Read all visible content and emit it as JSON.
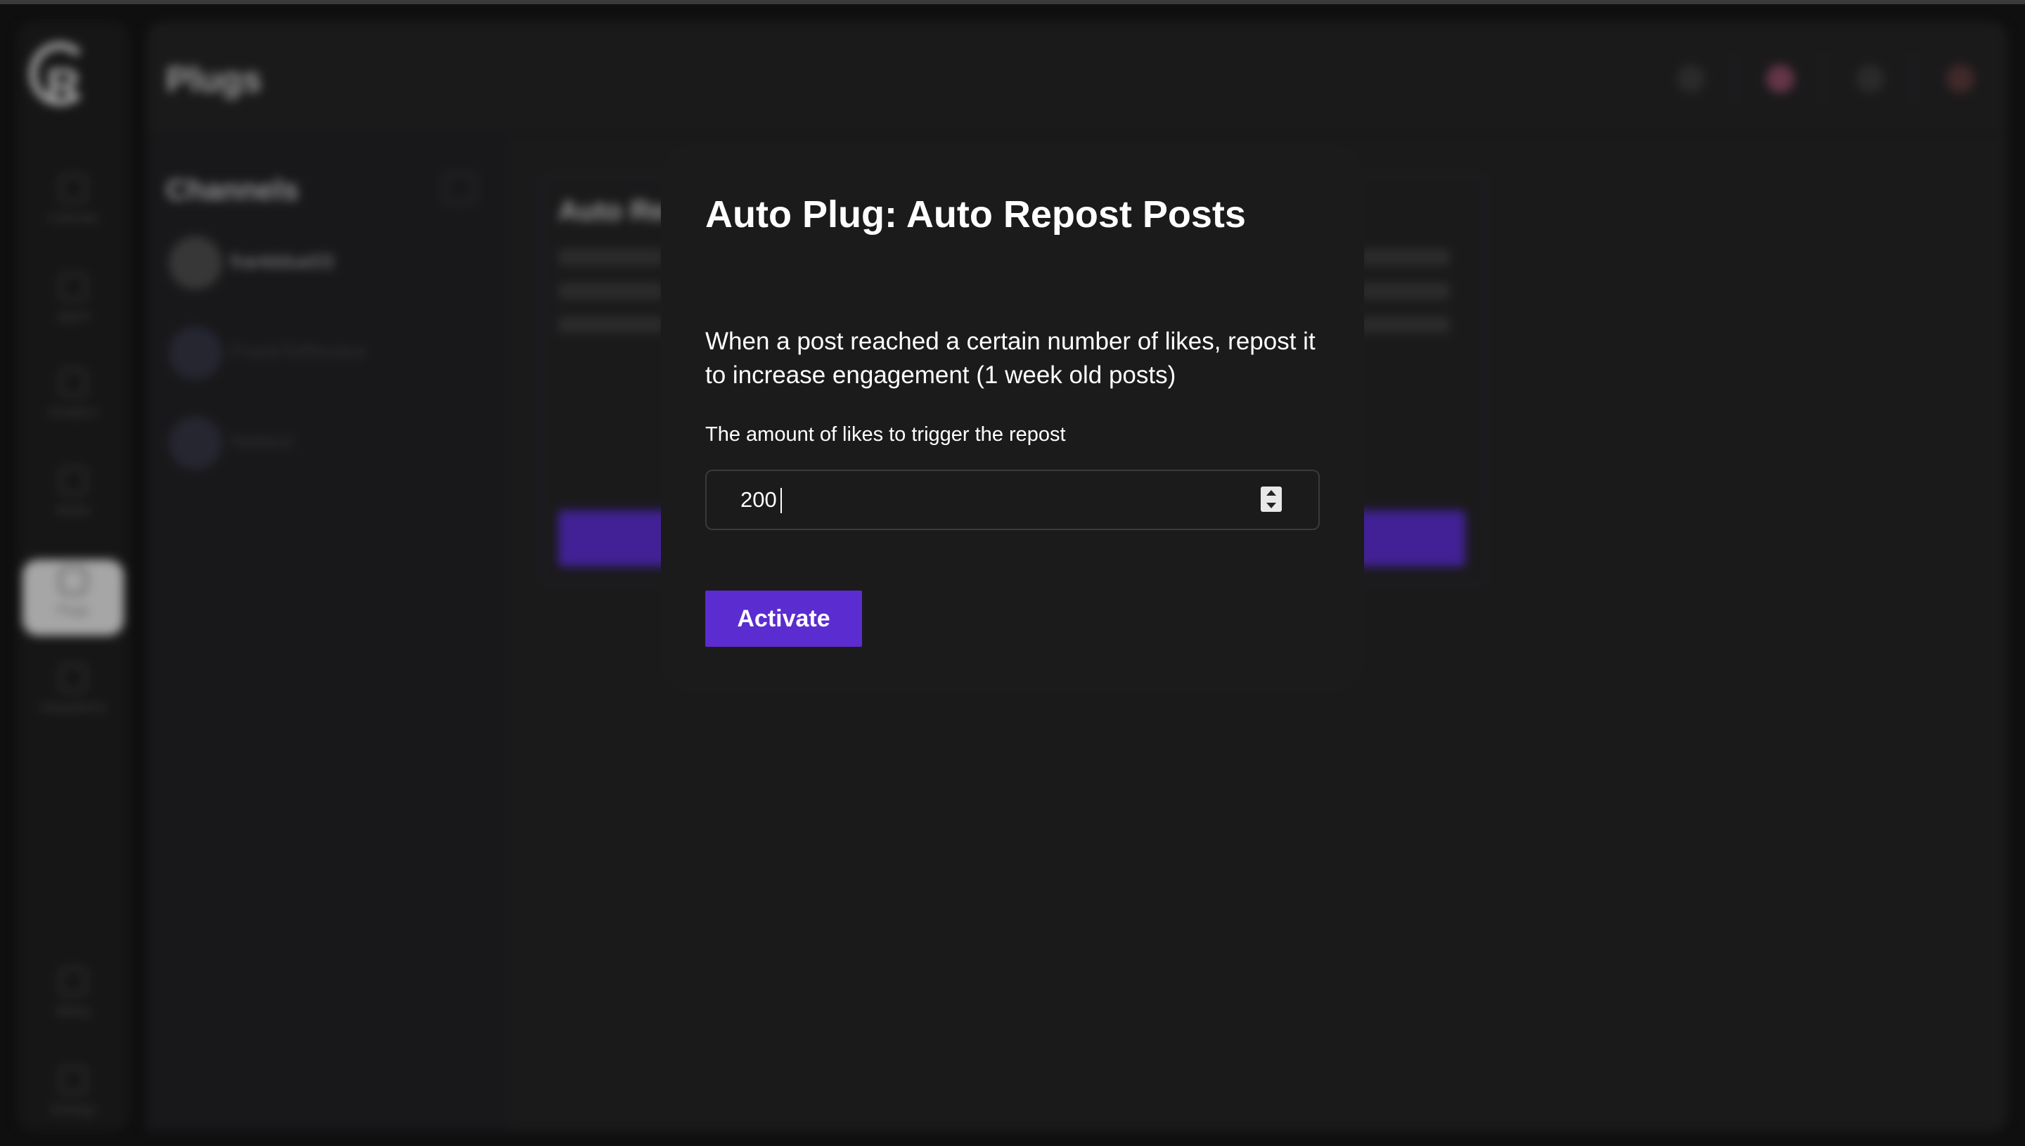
{
  "header": {
    "page_title": "Plugs"
  },
  "sidebar": {
    "items": [
      {
        "label": "Calendar",
        "icon": "calendar-icon"
      },
      {
        "label": "Agent",
        "icon": "agent-icon"
      },
      {
        "label": "Analytics",
        "icon": "analytics-icon"
      },
      {
        "label": "Media",
        "icon": "media-icon"
      },
      {
        "label": "Plugs",
        "icon": "plug-icon",
        "active": true
      },
      {
        "label": "Integrations",
        "icon": "integrations-icon"
      },
      {
        "label": "Billing",
        "icon": "billing-icon"
      },
      {
        "label": "Settings",
        "icon": "settings-icon"
      }
    ]
  },
  "channels": {
    "title": "Channels",
    "items": [
      {
        "name": "frankblue03"
      },
      {
        "name": "FrankToReview"
      },
      {
        "name": "Nettest"
      }
    ]
  },
  "plug_card": {
    "title": "Auto Re"
  },
  "modal": {
    "title": "Auto Plug: Auto Repost Posts",
    "description": "When a post reached a certain number of likes, repost it to increase engagement (1 week old posts)",
    "field_label": "The amount of likes to trigger the repost",
    "field_value": "200",
    "activate_label": "Activate"
  },
  "colors": {
    "accent": "#5b2ccf",
    "modal_bg": "#1b1b1c",
    "page_bg": "#252426"
  }
}
